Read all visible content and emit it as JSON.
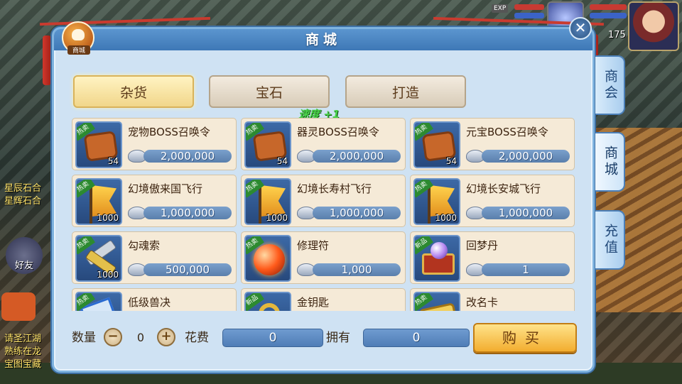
{
  "hud": {
    "left_texts": [
      "星辰石合",
      "星辉石合"
    ],
    "friend_label": "好友",
    "bottom_left_texts": [
      "请圣江湖",
      "熟练在龙",
      "宝图宝藏"
    ],
    "exp_label": "EXP",
    "level": "175"
  },
  "shop": {
    "title": "商城",
    "emblem_label": "商城",
    "close_symbol": "✕",
    "tabs": [
      {
        "label": "杂货",
        "active": true
      },
      {
        "label": "宝石",
        "active": false
      },
      {
        "label": "打造",
        "active": false
      }
    ],
    "buff_text": "速度 +1",
    "items": [
      {
        "badge": "热卖",
        "icon": "boss-token-icon",
        "glyph": "token",
        "qty": "54",
        "name": "宠物BOSS召唤令",
        "price": "2,000,000"
      },
      {
        "badge": "热卖",
        "icon": "boss-token-icon",
        "glyph": "token",
        "qty": "54",
        "name": "器灵BOSS召唤令",
        "price": "2,000,000"
      },
      {
        "badge": "热卖",
        "icon": "boss-token-icon",
        "glyph": "token",
        "qty": "54",
        "name": "元宝BOSS召唤令",
        "price": "2,000,000"
      },
      {
        "badge": "热卖",
        "icon": "flying-flag-icon",
        "glyph": "flag",
        "qty": "1000",
        "name": "幻境傲来国飞行",
        "price": "1,000,000"
      },
      {
        "badge": "热卖",
        "icon": "flying-flag-icon",
        "glyph": "flag",
        "qty": "1000",
        "name": "幻境长寿村飞行",
        "price": "1,000,000"
      },
      {
        "badge": "热卖",
        "icon": "flying-flag-icon",
        "glyph": "flag",
        "qty": "1000",
        "name": "幻境长安城飞行",
        "price": "1,000,000"
      },
      {
        "badge": "热卖",
        "icon": "hook-rope-icon",
        "glyph": "hook",
        "qty": "1000",
        "name": "勾魂索",
        "price": "500,000"
      },
      {
        "badge": "热卖",
        "icon": "repair-orb-icon",
        "glyph": "orb",
        "qty": "",
        "name": "修理符",
        "price": "1,000"
      },
      {
        "badge": "新品",
        "icon": "dream-pill-chest-icon",
        "glyph": "chest",
        "qty": "",
        "name": "回梦丹",
        "price": "1"
      },
      {
        "badge": "热卖",
        "icon": "beast-scroll-icon",
        "glyph": "scroll",
        "qty": "",
        "name": "低级兽决",
        "price": ""
      },
      {
        "badge": "新品",
        "icon": "golden-key-icon",
        "glyph": "key",
        "qty": "",
        "name": "金钥匙",
        "price": ""
      },
      {
        "badge": "热卖",
        "icon": "rename-card-icon",
        "glyph": "card",
        "qty": "",
        "name": "改名卡",
        "price": ""
      }
    ],
    "footer": {
      "qty_label": "数量",
      "minus": "−",
      "plus": "+",
      "qty_value": "0",
      "cost_label": "花费",
      "cost_value": "0",
      "own_label": "拥有",
      "own_value": "0",
      "buy_label": "购买"
    },
    "side_tabs": [
      {
        "label": "商会",
        "active": false
      },
      {
        "label": "商城",
        "active": true
      },
      {
        "label": "充值",
        "active": false
      }
    ]
  },
  "colors": {
    "panel_bg": "#cfe2f3",
    "accent_blue": "#3e78b6",
    "buy_gold": "#f2ad2f",
    "hot_badge": "#2c8a30"
  }
}
